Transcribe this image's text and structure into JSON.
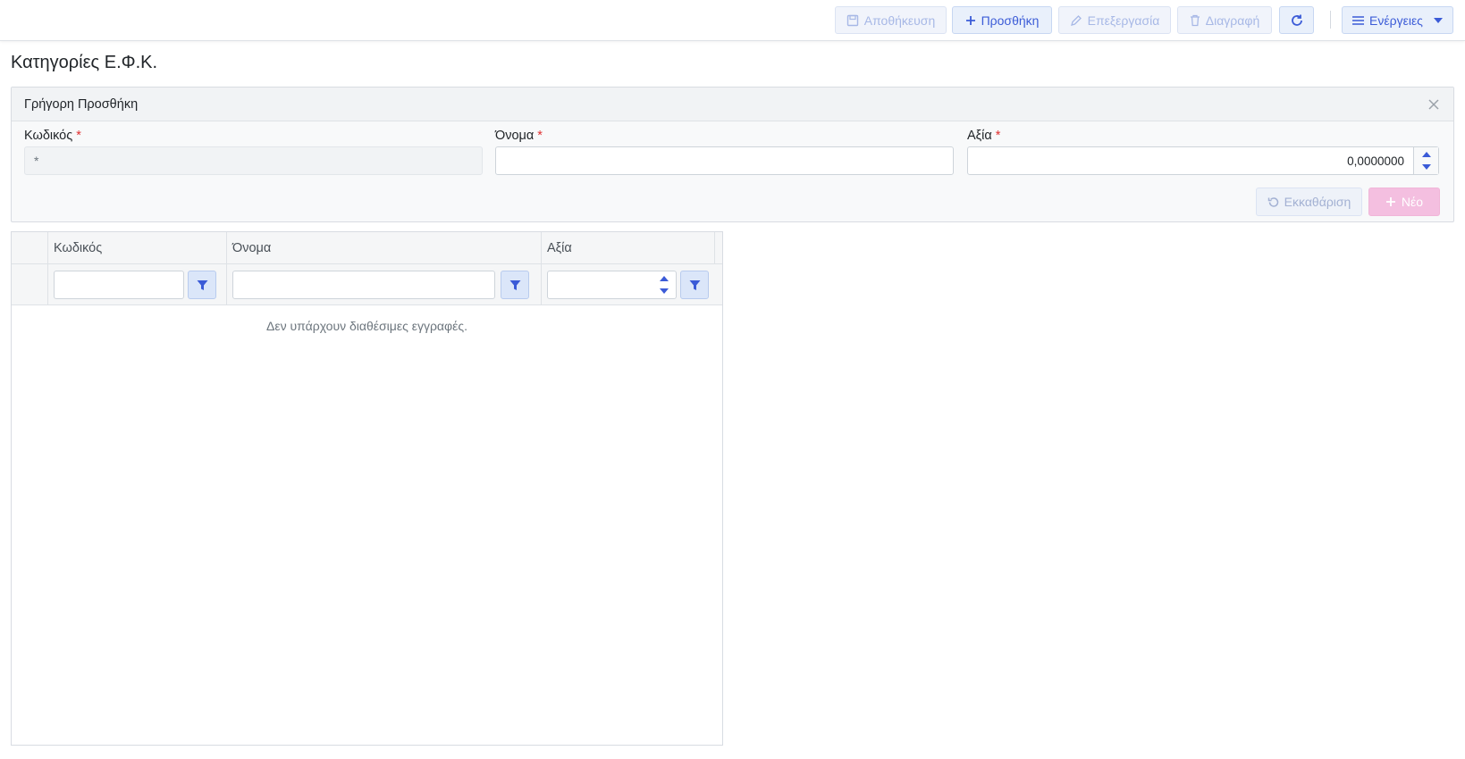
{
  "toolbar": {
    "save_label": "Αποθήκευση",
    "add_label": "Προσθήκη",
    "edit_label": "Επεξεργασία",
    "delete_label": "Διαγραφή",
    "actions_label": "Ενέργειες"
  },
  "page": {
    "title": "Κατηγορίες Ε.Φ.Κ."
  },
  "quick_add": {
    "title": "Γρήγορη Προσθήκη",
    "fields": {
      "code": {
        "label": "Κωδικός",
        "required_mark": "*",
        "value": "*"
      },
      "name": {
        "label": "Όνομα",
        "required_mark": "*",
        "value": ""
      },
      "value": {
        "label": "Αξία",
        "required_mark": "*",
        "value": "0,0000000"
      }
    },
    "clear_label": "Εκκαθάριση",
    "new_label": "Νέο"
  },
  "grid": {
    "columns": [
      "Κωδικός",
      "Όνομα",
      "Αξία"
    ],
    "empty_message": "Δεν υπάρχουν διαθέσιμες εγγραφές."
  },
  "colors": {
    "accent": "#3b5bd7",
    "new_button": "#f4bfe0",
    "required": "#e03131"
  }
}
